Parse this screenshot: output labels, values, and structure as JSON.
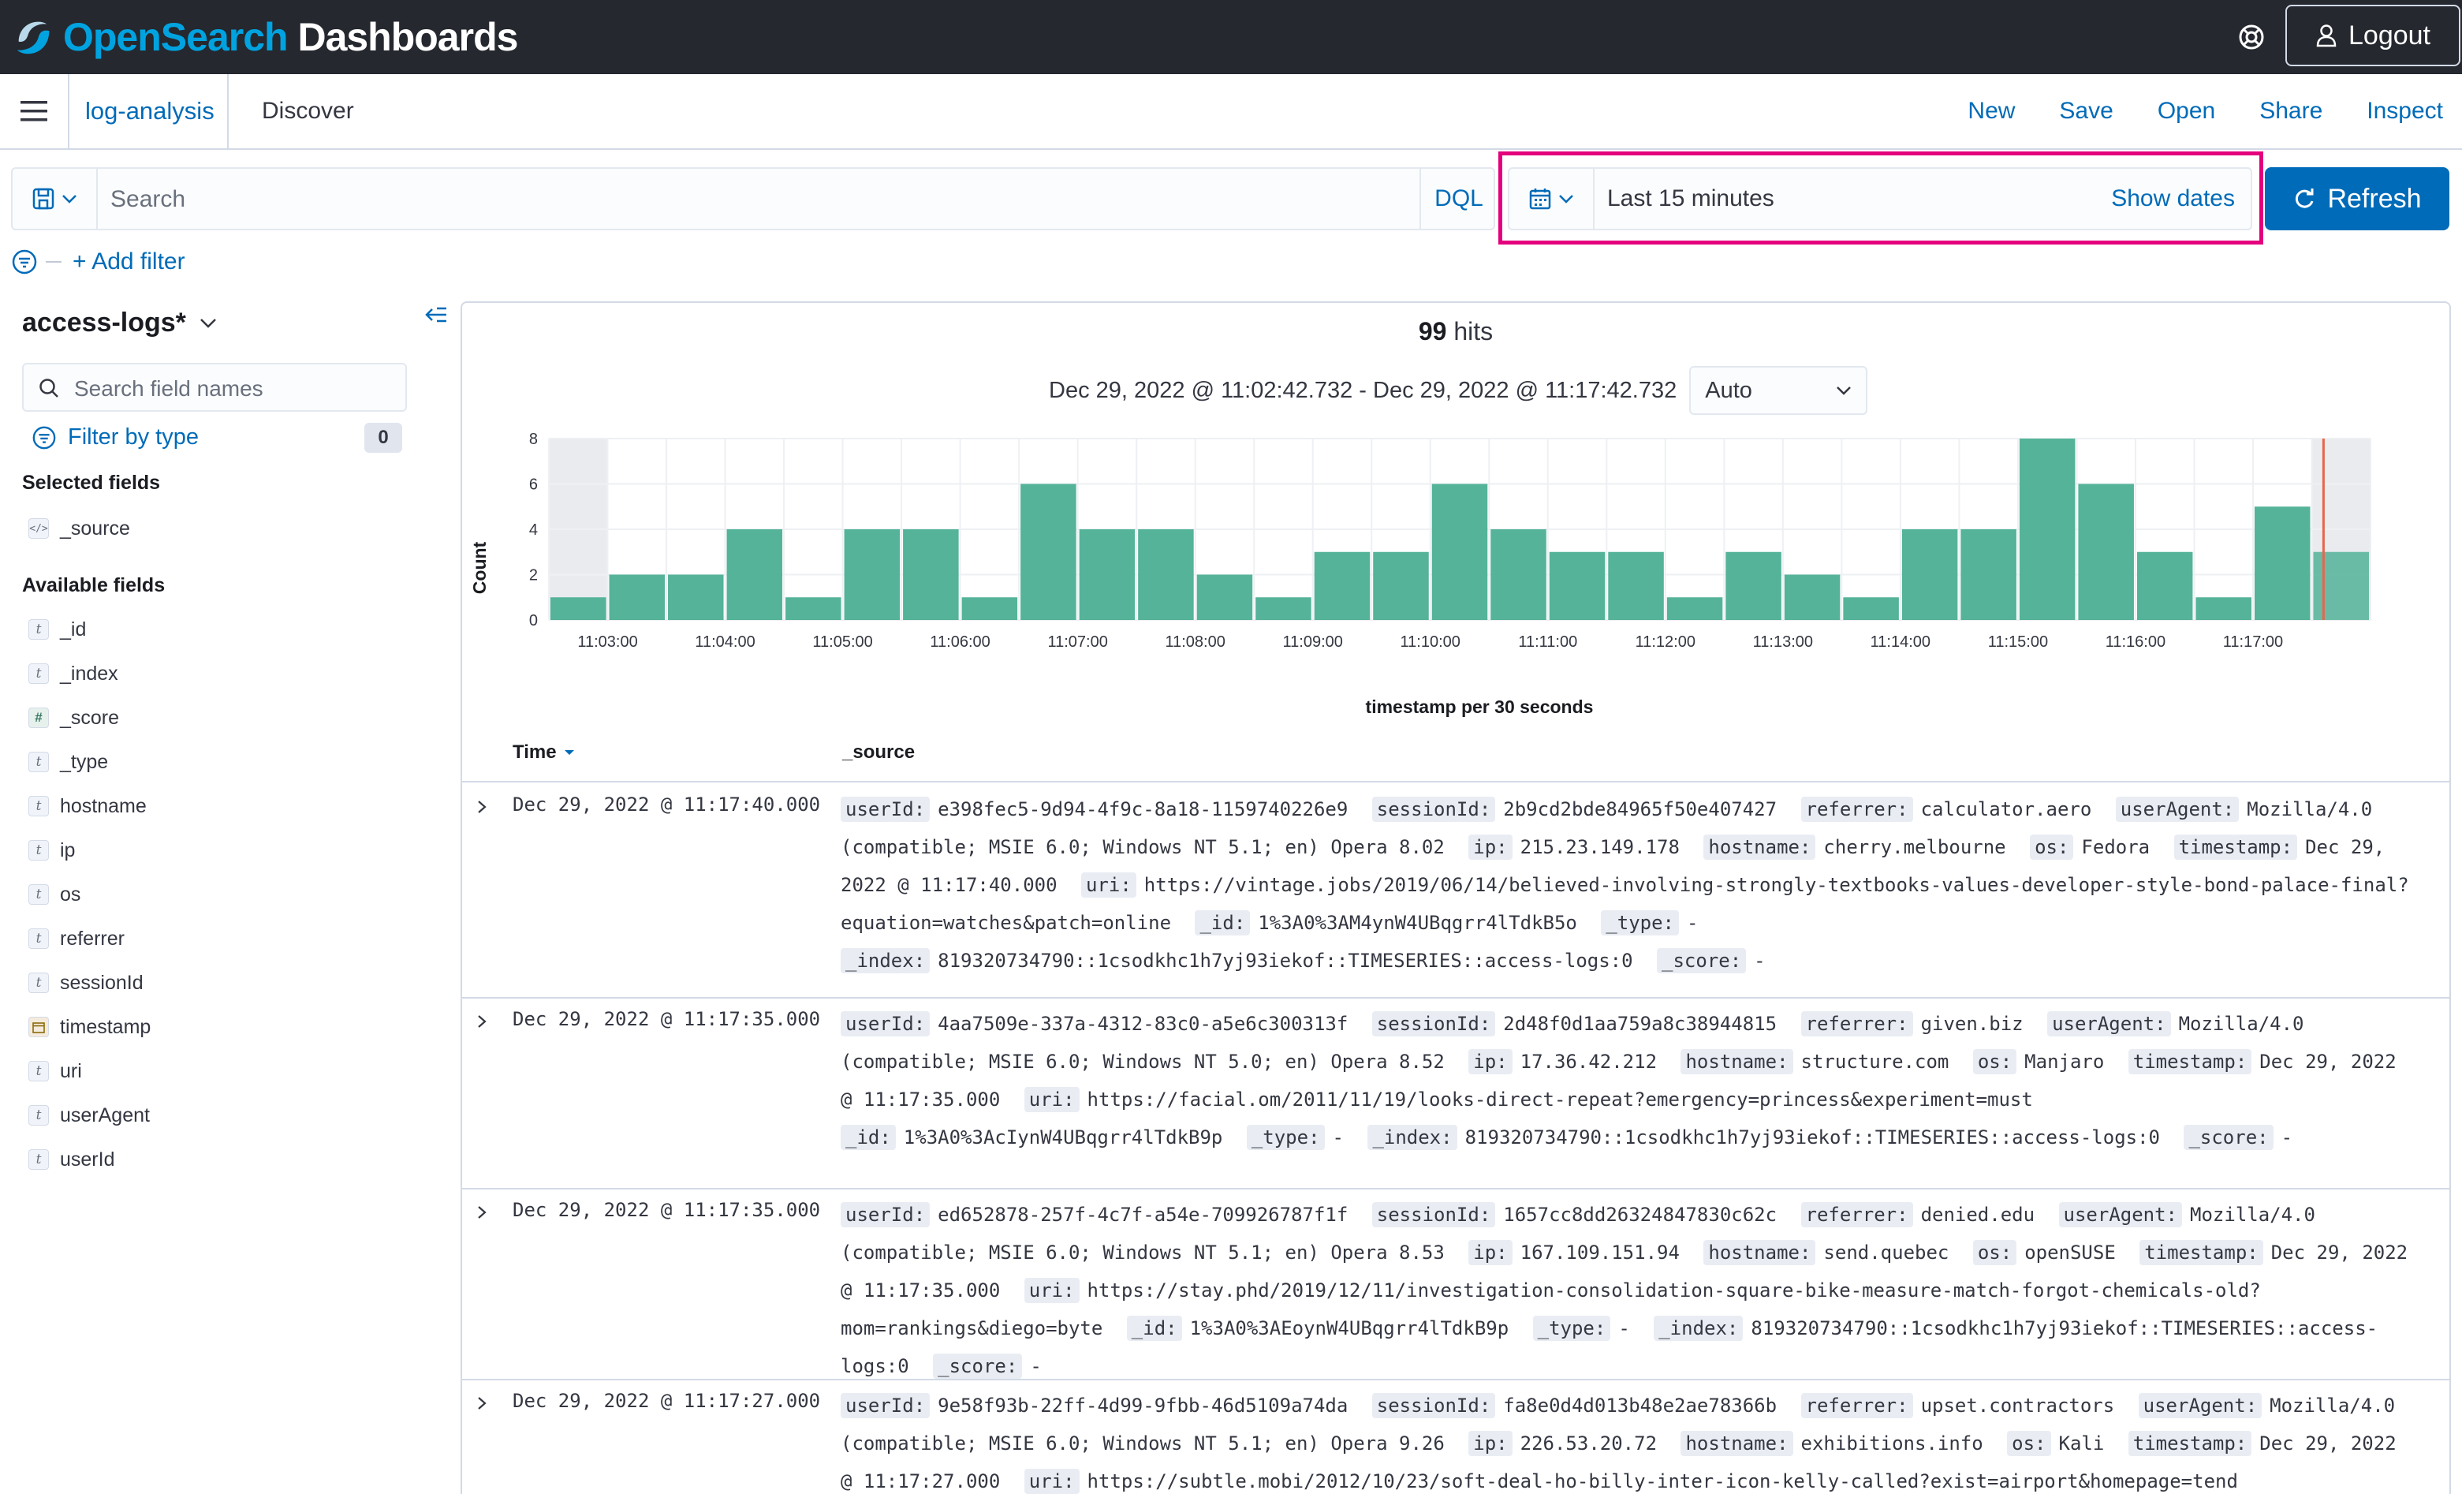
{
  "app": {
    "logo_brand": "OpenSearch",
    "logo_product": " Dashboards",
    "logout_label": "Logout"
  },
  "breadcrumb": {
    "app": "log-analysis",
    "page": "Discover"
  },
  "top_nav": [
    "New",
    "Save",
    "Open",
    "Share",
    "Inspect"
  ],
  "query": {
    "placeholder": "Search",
    "language": "DQL"
  },
  "datepicker": {
    "range": "Last 15 minutes",
    "show_dates": "Show dates",
    "refresh_label": "Refresh",
    "highlight_color": "#e4007c"
  },
  "filters": {
    "add_label": "+ Add filter"
  },
  "sidebar": {
    "index_pattern": "access-logs*",
    "field_search_placeholder": "Search field names",
    "filter_by_type": "Filter by type",
    "filter_count": "0",
    "selected_title": "Selected fields",
    "selected_fields": [
      {
        "name": "_source",
        "type": "source"
      }
    ],
    "available_title": "Available fields",
    "available_fields": [
      {
        "name": "_id",
        "type": "string"
      },
      {
        "name": "_index",
        "type": "string"
      },
      {
        "name": "_score",
        "type": "number"
      },
      {
        "name": "_type",
        "type": "string"
      },
      {
        "name": "hostname",
        "type": "string"
      },
      {
        "name": "ip",
        "type": "string"
      },
      {
        "name": "os",
        "type": "string"
      },
      {
        "name": "referrer",
        "type": "string"
      },
      {
        "name": "sessionId",
        "type": "string"
      },
      {
        "name": "timestamp",
        "type": "date"
      },
      {
        "name": "uri",
        "type": "string"
      },
      {
        "name": "userAgent",
        "type": "string"
      },
      {
        "name": "userId",
        "type": "string"
      }
    ]
  },
  "summary": {
    "hits_count": "99",
    "hits_label": " hits",
    "time_range": "Dec 29, 2022 @ 11:02:42.732 - Dec 29, 2022 @ 11:17:42.732",
    "interval": "Auto"
  },
  "chart_data": {
    "type": "bar",
    "categories": [
      "11:02:30",
      "11:03:00",
      "11:03:30",
      "11:04:00",
      "11:04:30",
      "11:05:00",
      "11:05:30",
      "11:06:00",
      "11:06:30",
      "11:07:00",
      "11:07:30",
      "11:08:00",
      "11:08:30",
      "11:09:00",
      "11:09:30",
      "11:10:00",
      "11:10:30",
      "11:11:00",
      "11:11:30",
      "11:12:00",
      "11:12:30",
      "11:13:00",
      "11:13:30",
      "11:14:00",
      "11:14:30",
      "11:15:00",
      "11:15:30",
      "11:16:00",
      "11:16:30",
      "11:17:00",
      "11:17:30"
    ],
    "values": [
      1,
      2,
      2,
      4,
      1,
      4,
      4,
      1,
      6,
      4,
      4,
      2,
      1,
      3,
      3,
      6,
      4,
      3,
      3,
      1,
      3,
      2,
      1,
      4,
      4,
      8,
      6,
      3,
      1,
      5,
      3
    ],
    "xlabel": "timestamp per 30 seconds",
    "ylabel": "Count",
    "ylim": [
      0,
      8
    ],
    "y_ticks": [
      0,
      2,
      4,
      6,
      8
    ],
    "x_tick_labels": [
      "11:03:00",
      "11:04:00",
      "11:05:00",
      "11:06:00",
      "11:07:00",
      "11:08:00",
      "11:09:00",
      "11:10:00",
      "11:11:00",
      "11:12:00",
      "11:13:00",
      "11:14:00",
      "11:15:00",
      "11:16:00",
      "11:17:00"
    ],
    "bar_color": "#54b399",
    "now_marker_color": "#e7664c",
    "grid": true
  },
  "table": {
    "time_header": "Time",
    "source_header": "_source",
    "rows": [
      {
        "time": "Dec 29, 2022 @ 11:17:40.000",
        "fields": [
          {
            "k": "userId:",
            "v": "e398fec5-9d94-4f9c-8a18-1159740226e9"
          },
          {
            "k": "sessionId:",
            "v": "2b9cd2bde84965f50e407427"
          },
          {
            "k": "referrer:",
            "v": "calculator.aero"
          },
          {
            "k": "userAgent:",
            "v": "Mozilla/4.0 (compatible; MSIE 6.0; Windows NT 5.1; en) Opera 8.02"
          },
          {
            "k": "ip:",
            "v": "215.23.149.178"
          },
          {
            "k": "hostname:",
            "v": "cherry.melbourne"
          },
          {
            "k": "os:",
            "v": "Fedora"
          },
          {
            "k": "timestamp:",
            "v": "Dec 29, 2022 @ 11:17:40.000"
          },
          {
            "k": "uri:",
            "v": "https://vintage.jobs/2019/06/14/believed-involving-strongly-textbooks-values-developer-style-bond-palace-final?equation=watches&patch=online"
          },
          {
            "k": "_id:",
            "v": "1%3A0%3AM4ynW4UBqgrr4lTdkB5o"
          },
          {
            "k": "_type:",
            "v": "-"
          },
          {
            "k": "_index:",
            "v": "819320734790::1csodkhc1h7yj93iekof::TIMESERIES::access-logs:0"
          },
          {
            "k": "_score:",
            "v": "-"
          }
        ]
      },
      {
        "time": "Dec 29, 2022 @ 11:17:35.000",
        "fields": [
          {
            "k": "userId:",
            "v": "4aa7509e-337a-4312-83c0-a5e6c300313f"
          },
          {
            "k": "sessionId:",
            "v": "2d48f0d1aa759a8c38944815"
          },
          {
            "k": "referrer:",
            "v": "given.biz"
          },
          {
            "k": "userAgent:",
            "v": "Mozilla/4.0 (compatible; MSIE 6.0; Windows NT 5.0; en) Opera 8.52"
          },
          {
            "k": "ip:",
            "v": "17.36.42.212"
          },
          {
            "k": "hostname:",
            "v": "structure.com"
          },
          {
            "k": "os:",
            "v": "Manjaro"
          },
          {
            "k": "timestamp:",
            "v": "Dec 29, 2022 @ 11:17:35.000"
          },
          {
            "k": "uri:",
            "v": "https://facial.om/2011/11/19/looks-direct-repeat?emergency=princess&experiment=must"
          },
          {
            "k": "_id:",
            "v": "1%3A0%3AcIynW4UBqgrr4lTdkB9p"
          },
          {
            "k": "_type:",
            "v": "-"
          },
          {
            "k": "_index:",
            "v": "819320734790::1csodkhc1h7yj93iekof::TIMESERIES::access-logs:0"
          },
          {
            "k": "_score:",
            "v": "-"
          }
        ]
      },
      {
        "time": "Dec 29, 2022 @ 11:17:35.000",
        "fields": [
          {
            "k": "userId:",
            "v": "ed652878-257f-4c7f-a54e-709926787f1f"
          },
          {
            "k": "sessionId:",
            "v": "1657cc8dd26324847830c62c"
          },
          {
            "k": "referrer:",
            "v": "denied.edu"
          },
          {
            "k": "userAgent:",
            "v": "Mozilla/4.0 (compatible; MSIE 6.0; Windows NT 5.1; en) Opera 8.53"
          },
          {
            "k": "ip:",
            "v": "167.109.151.94"
          },
          {
            "k": "hostname:",
            "v": "send.quebec"
          },
          {
            "k": "os:",
            "v": "openSUSE"
          },
          {
            "k": "timestamp:",
            "v": "Dec 29, 2022 @ 11:17:35.000"
          },
          {
            "k": "uri:",
            "v": "https://stay.phd/2019/12/11/investigation-consolidation-square-bike-measure-match-forgot-chemicals-old?mom=rankings&diego=byte"
          },
          {
            "k": "_id:",
            "v": "1%3A0%3AEoynW4UBqgrr4lTdkB9p"
          },
          {
            "k": "_type:",
            "v": "-"
          },
          {
            "k": "_index:",
            "v": "819320734790::1csodkhc1h7yj93iekof::TIMESERIES::access-logs:0"
          },
          {
            "k": "_score:",
            "v": "-"
          }
        ]
      },
      {
        "time": "Dec 29, 2022 @ 11:17:27.000",
        "fields": [
          {
            "k": "userId:",
            "v": "9e58f93b-22ff-4d99-9fbb-46d5109a74da"
          },
          {
            "k": "sessionId:",
            "v": "fa8e0d4d013b48e2ae78366b"
          },
          {
            "k": "referrer:",
            "v": "upset.contractors"
          },
          {
            "k": "userAgent:",
            "v": "Mozilla/4.0 (compatible; MSIE 6.0; Windows NT 5.1; en) Opera 9.26"
          },
          {
            "k": "ip:",
            "v": "226.53.20.72"
          },
          {
            "k": "hostname:",
            "v": "exhibitions.info"
          },
          {
            "k": "os:",
            "v": "Kali"
          },
          {
            "k": "timestamp:",
            "v": "Dec 29, 2022 @ 11:17:27.000"
          },
          {
            "k": "uri:",
            "v": "https://subtle.mobi/2012/10/23/soft-deal-ho-billy-inter-icon-kelly-called?exist=airport&homepage=tend"
          }
        ]
      }
    ]
  }
}
